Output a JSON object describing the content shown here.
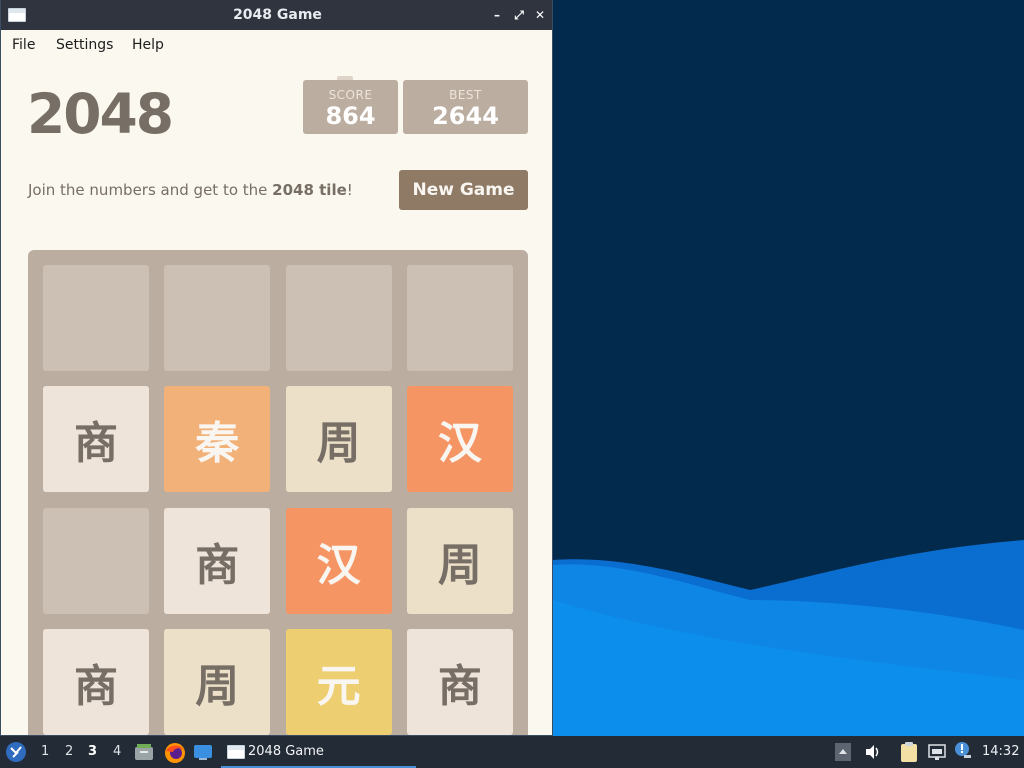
{
  "window": {
    "title": "2048 Game"
  },
  "menu": {
    "file": "File",
    "settings": "Settings",
    "help": "Help"
  },
  "game": {
    "heading": "2048",
    "score_label": "SCORE",
    "score_value": "864",
    "best_label": "BEST",
    "best_value": "2644",
    "intro_prefix": "Join the numbers and get to the ",
    "intro_bold": "2048 tile",
    "intro_suffix": "!",
    "new_game_label": "New Game",
    "board": [
      [
        "",
        "",
        "",
        ""
      ],
      [
        "商",
        "秦",
        "周",
        "汉"
      ],
      [
        "",
        "商",
        "汉",
        "周"
      ],
      [
        "商",
        "周",
        "元",
        "商"
      ]
    ],
    "tile_colors": {
      "商": {
        "bg": "#eee4da",
        "fg": "#776e65"
      },
      "周": {
        "bg": "#ede0c8",
        "fg": "#776e65"
      },
      "秦": {
        "bg": "#f2b179",
        "fg": "#f9f6f2"
      },
      "汉": {
        "bg": "#f59563",
        "fg": "#f9f6f2"
      },
      "元": {
        "bg": "#edcf72",
        "fg": "#f9f6f2"
      }
    }
  },
  "taskbar": {
    "workspaces": [
      "1",
      "2",
      "3",
      "4"
    ],
    "active_workspace": "3",
    "task_label": "2048 Game",
    "clock": "14:32"
  }
}
